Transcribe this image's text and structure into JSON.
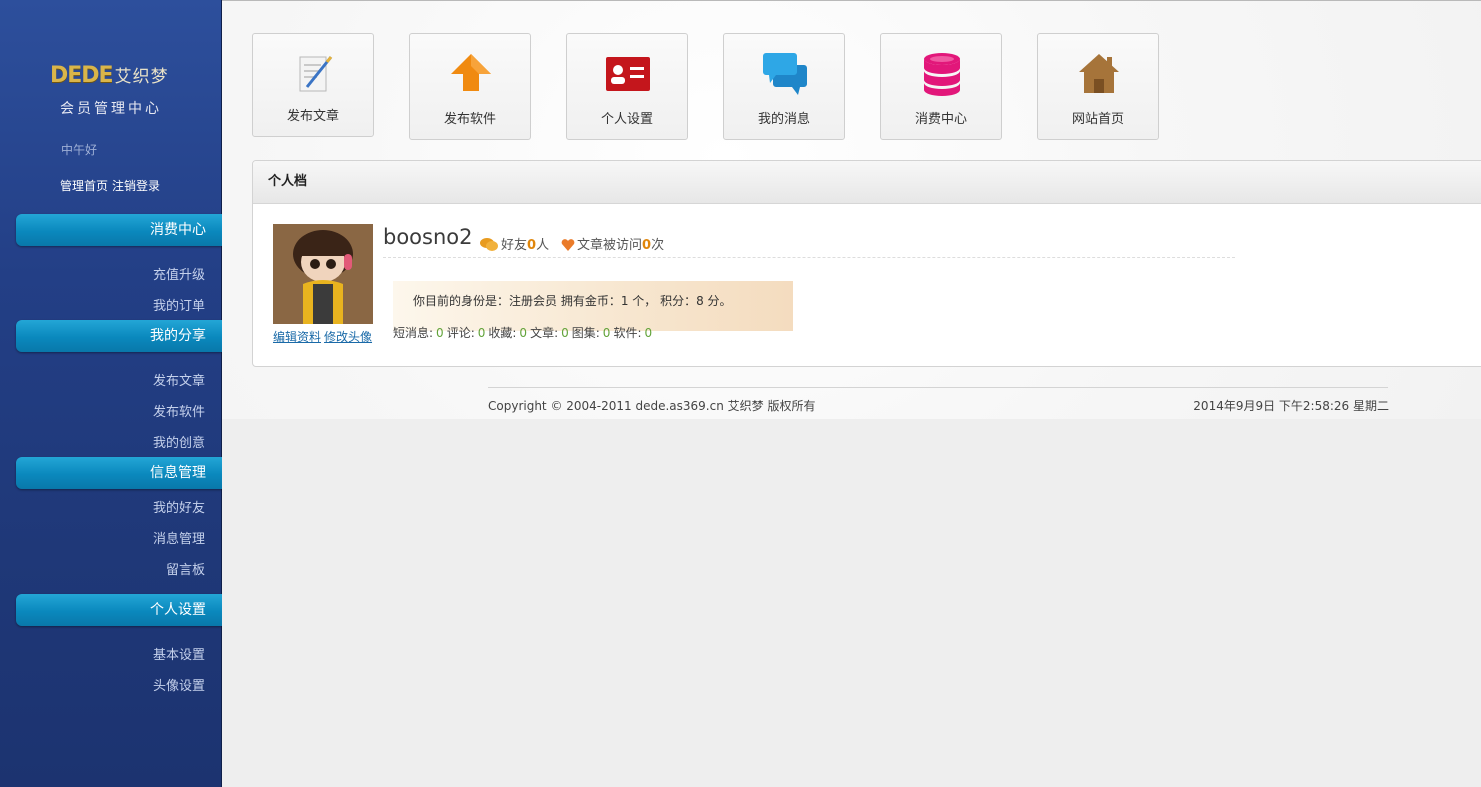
{
  "brand": {
    "mark": "DEDE",
    "name": "艾织梦",
    "subtitle": "会员管理中心"
  },
  "greeting": "中午好",
  "top_links": {
    "home": "管理首页",
    "logout": "注销登录"
  },
  "menu": [
    {
      "title": "消费中心",
      "items": [
        "充值升级",
        "我的订单"
      ]
    },
    {
      "title": "我的分享",
      "items": [
        "发布文章",
        "发布软件",
        "我的创意"
      ]
    },
    {
      "title": "信息管理",
      "items": [
        "我的好友",
        "消息管理",
        "留言板"
      ]
    },
    {
      "title": "个人设置",
      "items": [
        "基本设置",
        "头像设置"
      ]
    }
  ],
  "tiles": [
    {
      "label": "发布文章",
      "icon": "edit-document-icon"
    },
    {
      "label": "发布软件",
      "icon": "upload-arrow-icon"
    },
    {
      "label": "个人设置",
      "icon": "id-card-icon"
    },
    {
      "label": "我的消息",
      "icon": "chat-bubbles-icon"
    },
    {
      "label": "消费中心",
      "icon": "coins-stack-icon"
    },
    {
      "label": "网站首页",
      "icon": "home-icon"
    }
  ],
  "profile": {
    "panel_title": "个人档",
    "username": "boosno2",
    "friends_prefix": "好友",
    "friends_count": "0",
    "friends_suffix": "人",
    "visits_prefix": "文章被访问",
    "visits_count": "0",
    "visits_suffix": "次",
    "identity_line": "你目前的身份是：注册会员 拥有金币：1 个， 积分：8 分。",
    "edit_profile": "编辑资料",
    "change_avatar": "修改头像",
    "counts": {
      "messages_label": "短消息:",
      "messages": "0",
      "comments_label": "评论:",
      "comments": "0",
      "favorites_label": "收藏:",
      "favorites": "0",
      "articles_label": "文章:",
      "articles": "0",
      "albums_label": "图集:",
      "albums": "0",
      "software_label": "软件:",
      "software": "0"
    }
  },
  "footer": {
    "copyright": "Copyright © 2004-2011 dede.as369.cn 艾织梦 版权所有",
    "datetime": "2014年9月9日 下午2:58:26 星期二"
  },
  "colors": {
    "sidebar": "#233f86",
    "menu_head": "#0a88bd",
    "count_number": "#62a33a",
    "stat_number": "#e0860b"
  }
}
